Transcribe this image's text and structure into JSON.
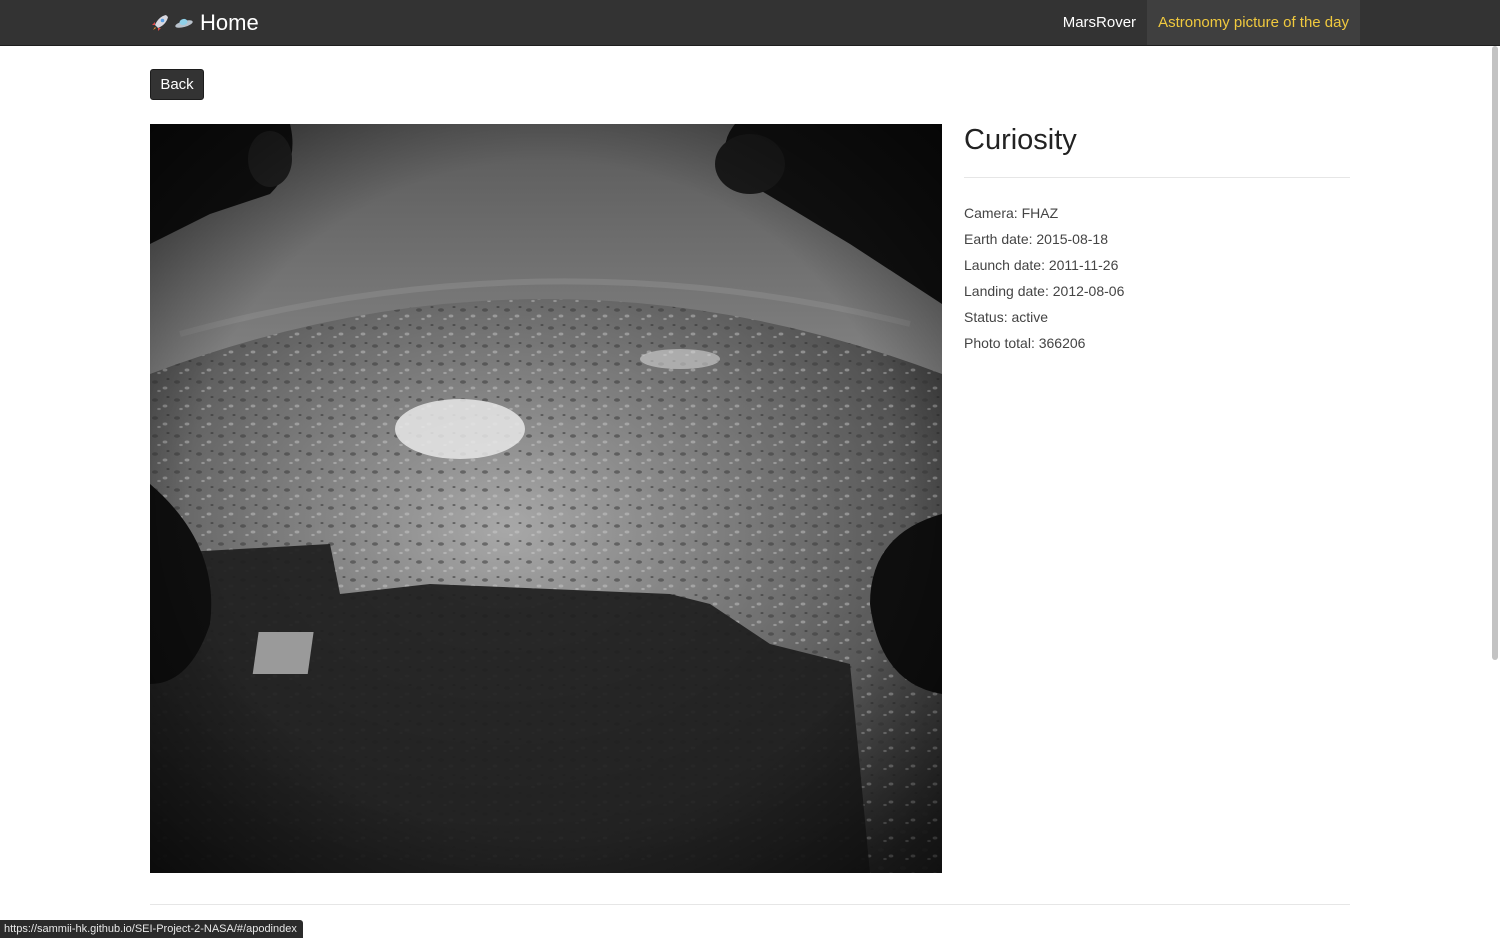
{
  "navbar": {
    "brand_label": "Home",
    "brand_icons": [
      "rocket-icon",
      "ufo-icon"
    ],
    "links": [
      {
        "label": "MarsRover",
        "active": false
      },
      {
        "label": "Astronomy picture of the day",
        "active": true
      }
    ],
    "accent_color": "#f0c93e",
    "background_color": "#333333"
  },
  "back_button_label": "Back",
  "rover": {
    "name": "Curiosity",
    "camera": "Camera: FHAZ",
    "earth_date": "Earth date: 2015-08-18",
    "launch_date": "Launch date: 2011-11-26",
    "landing_date": "Landing date: 2012-08-06",
    "status": "Status: active",
    "photo_total": "Photo total: 366206"
  },
  "status_bar_url": "https://sammii-hk.github.io/SEI-Project-2-NASA/#/apodindex"
}
